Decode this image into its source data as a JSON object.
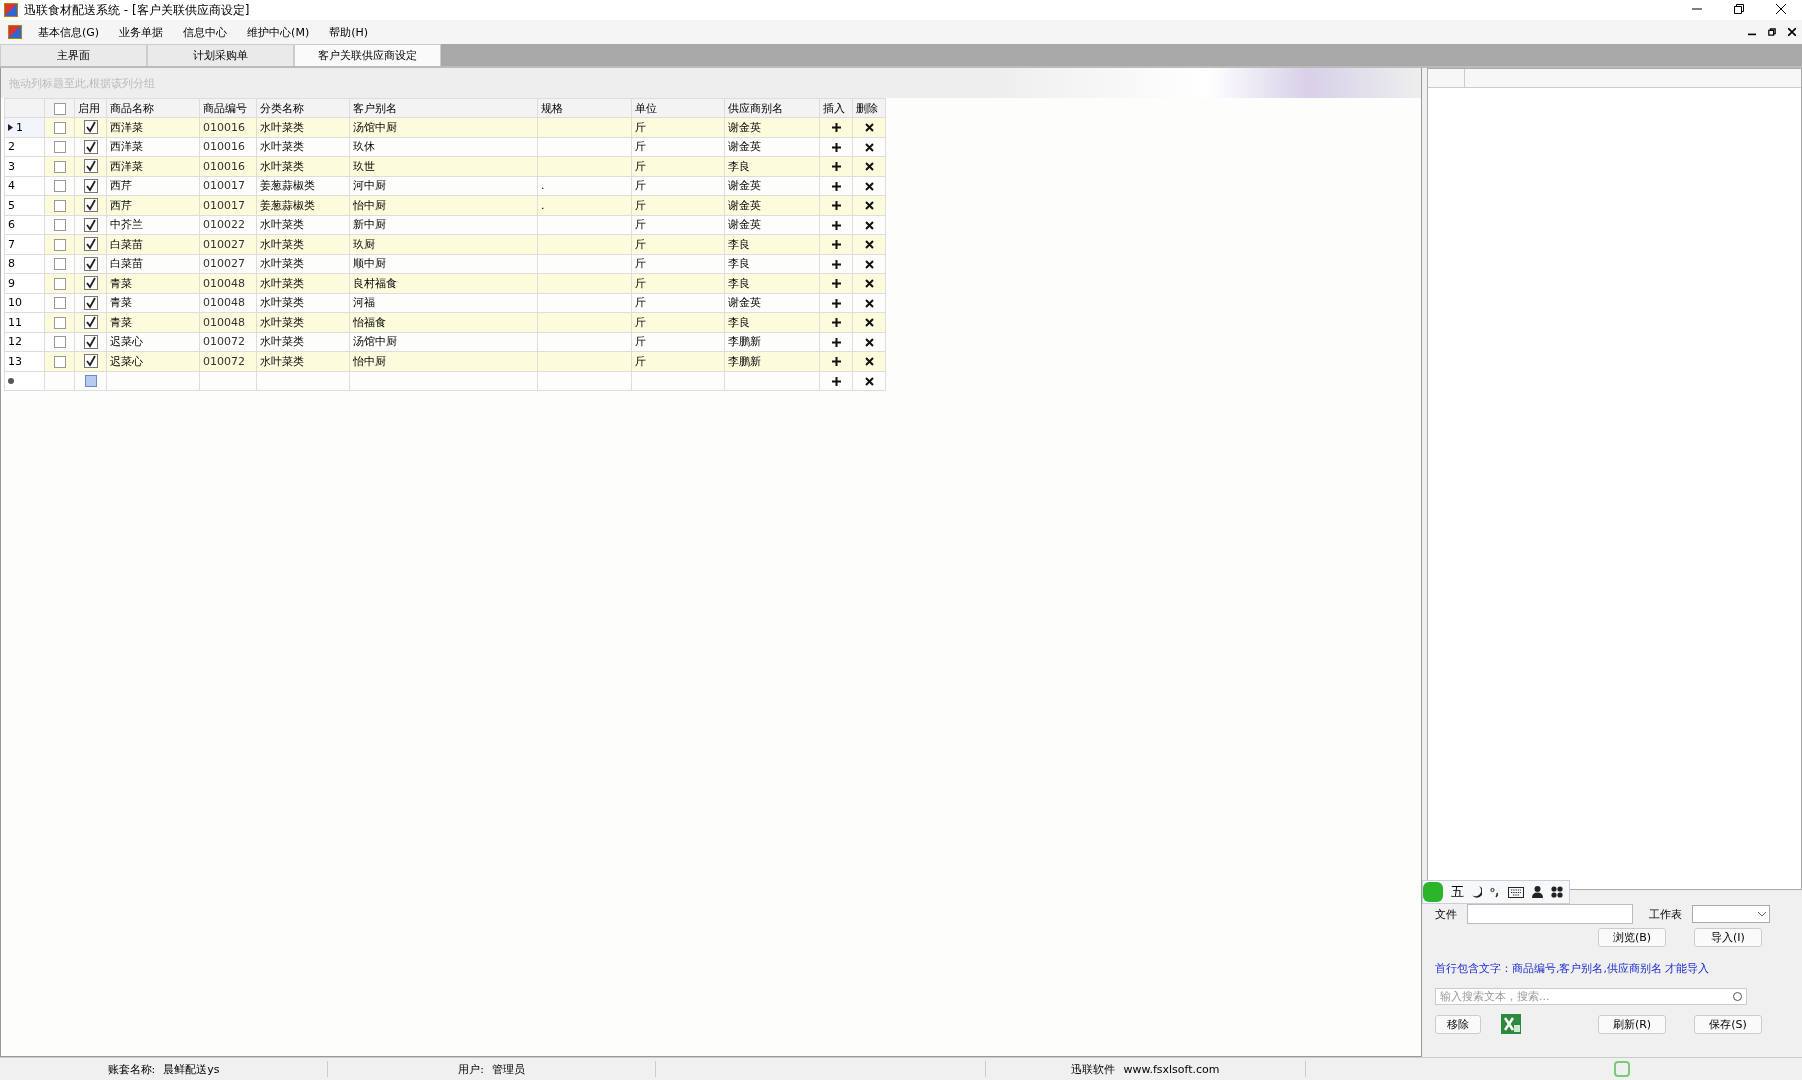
{
  "window": {
    "title": "迅联食材配送系统 - [客户关联供应商设定]"
  },
  "menu": [
    "基本信息(G)",
    "业务单据",
    "信息中心",
    "维护中心(M)",
    "帮助(H)"
  ],
  "tabs": [
    {
      "label": "主界面",
      "selected": false
    },
    {
      "label": "计划采购单",
      "selected": false
    },
    {
      "label": "客户关联供应商设定",
      "selected": true
    }
  ],
  "group_hint": "拖动列标题至此,根据该列分组",
  "table": {
    "select_all_checked": false,
    "columns": [
      "启用",
      "商品名称",
      "商品编号",
      "分类名称",
      "客户别名",
      "规格",
      "单位",
      "供应商别名",
      "插入",
      "删除"
    ],
    "rows": [
      {
        "num": "1",
        "selected": true,
        "checked": false,
        "enabled": true,
        "name": "西洋菜",
        "code": "010016",
        "category": "水叶菜类",
        "alias": "汤馆中厨",
        "spec": "",
        "unit": "斤",
        "supplier": "谢金英"
      },
      {
        "num": "2",
        "selected": false,
        "checked": false,
        "enabled": true,
        "name": "西洋菜",
        "code": "010016",
        "category": "水叶菜类",
        "alias": "玖休",
        "spec": "",
        "unit": "斤",
        "supplier": "谢金英"
      },
      {
        "num": "3",
        "selected": false,
        "checked": false,
        "enabled": true,
        "name": "西洋菜",
        "code": "010016",
        "category": "水叶菜类",
        "alias": "玖世",
        "spec": "",
        "unit": "斤",
        "supplier": "李良"
      },
      {
        "num": "4",
        "selected": false,
        "checked": false,
        "enabled": true,
        "name": "西芹",
        "code": "010017",
        "category": "姜葱蒜椒类",
        "alias": "河中厨",
        "spec": ".",
        "unit": "斤",
        "supplier": "谢金英"
      },
      {
        "num": "5",
        "selected": false,
        "checked": false,
        "enabled": true,
        "name": "西芹",
        "code": "010017",
        "category": "姜葱蒜椒类",
        "alias": "怡中厨",
        "spec": ".",
        "unit": "斤",
        "supplier": "谢金英"
      },
      {
        "num": "6",
        "selected": false,
        "checked": false,
        "enabled": true,
        "name": "中芥兰",
        "code": "010022",
        "category": "水叶菜类",
        "alias": "新中厨",
        "spec": "",
        "unit": "斤",
        "supplier": "谢金英"
      },
      {
        "num": "7",
        "selected": false,
        "checked": false,
        "enabled": true,
        "name": "白菜苗",
        "code": "010027",
        "category": "水叶菜类",
        "alias": "玖厨",
        "spec": "",
        "unit": "斤",
        "supplier": "李良"
      },
      {
        "num": "8",
        "selected": false,
        "checked": false,
        "enabled": true,
        "name": "白菜苗",
        "code": "010027",
        "category": "水叶菜类",
        "alias": "顺中厨",
        "spec": "",
        "unit": "斤",
        "supplier": "李良"
      },
      {
        "num": "9",
        "selected": false,
        "checked": false,
        "enabled": true,
        "name": "青菜",
        "code": "010048",
        "category": "水叶菜类",
        "alias": "良村福食",
        "spec": "",
        "unit": "斤",
        "supplier": "李良"
      },
      {
        "num": "10",
        "selected": false,
        "checked": false,
        "enabled": true,
        "name": "青菜",
        "code": "010048",
        "category": "水叶菜类",
        "alias": "河福",
        "spec": "",
        "unit": "斤",
        "supplier": "谢金英"
      },
      {
        "num": "11",
        "selected": false,
        "checked": false,
        "enabled": true,
        "name": "青菜",
        "code": "010048",
        "category": "水叶菜类",
        "alias": "怡福食",
        "spec": "",
        "unit": "斤",
        "supplier": "李良"
      },
      {
        "num": "12",
        "selected": false,
        "checked": false,
        "enabled": true,
        "name": "迟菜心",
        "code": "010072",
        "category": "水叶菜类",
        "alias": "汤馆中厨",
        "spec": "",
        "unit": "斤",
        "supplier": "李鹏新"
      },
      {
        "num": "13",
        "selected": false,
        "checked": false,
        "enabled": true,
        "name": "迟菜心",
        "code": "010072",
        "category": "水叶菜类",
        "alias": "怡中厨",
        "spec": "",
        "unit": "斤",
        "supplier": "李鹏新"
      }
    ]
  },
  "ime_toolbar": {
    "mode": "五"
  },
  "import_panel": {
    "file_label": "文件",
    "sheet_label": "工作表",
    "browse_button": "浏览(B)",
    "import_button": "导入(I)",
    "note": "首行包含文字：商品编号,客户别名,供应商别名 才能导入",
    "search_placeholder": "输入搜索文本，搜索...",
    "remove_button": "移除",
    "refresh_button": "刷新(R)",
    "save_button": "保存(S)"
  },
  "status_bar": {
    "account_label": "账套名称:",
    "account": "晨鲜配送ys",
    "user_label": "用户:",
    "user": "管理员",
    "vendor": "迅联软件",
    "website": "www.fsxlsoft.com"
  }
}
